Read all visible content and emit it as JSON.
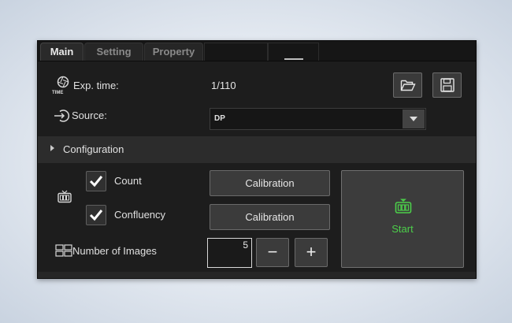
{
  "tabs": [
    "Main",
    "Setting",
    "Property"
  ],
  "exposure": {
    "label": "Exp. time:",
    "value": "1/110",
    "icon_caption": "TIME"
  },
  "source": {
    "label": "Source:",
    "selected": "DP"
  },
  "section": {
    "label": "Configuration"
  },
  "options": [
    {
      "label": "Count",
      "checked": true,
      "button": "Calibration"
    },
    {
      "label": "Confluency",
      "checked": true,
      "button": "Calibration"
    }
  ],
  "images": {
    "label": "Number of Images",
    "value": "5",
    "decrement": "−",
    "increment": "+"
  },
  "start": {
    "label": "Start"
  },
  "colors": {
    "accent_green": "#4ccf4a",
    "panel_bg": "#1d1d1d"
  },
  "icons": [
    "exposure-time-icon",
    "source-input-icon",
    "folder-open-icon",
    "save-icon",
    "counter-icon",
    "number-of-images-icon",
    "start-counter-icon"
  ]
}
